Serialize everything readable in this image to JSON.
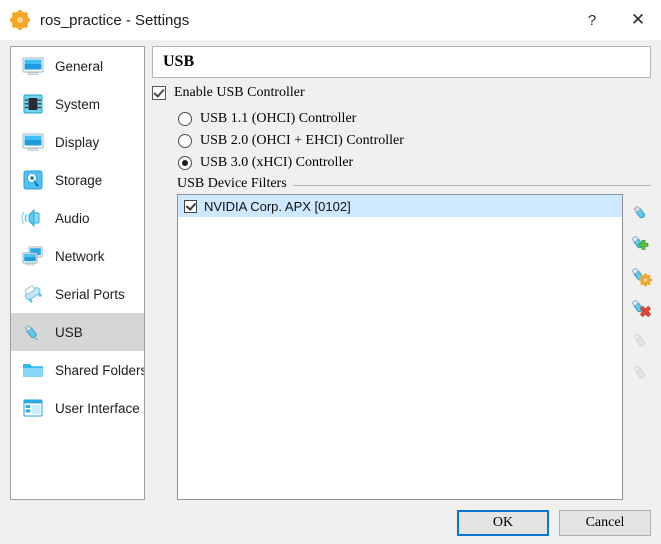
{
  "window": {
    "title": "ros_practice - Settings",
    "app_icon": "virtualbox-gear-icon",
    "help_label": "?",
    "close_label": "✕"
  },
  "sidebar": {
    "items": [
      {
        "label": "General",
        "icon": "monitor-icon",
        "selected": false
      },
      {
        "label": "System",
        "icon": "chip-icon",
        "selected": false
      },
      {
        "label": "Display",
        "icon": "display-icon",
        "selected": false
      },
      {
        "label": "Storage",
        "icon": "harddisk-icon",
        "selected": false
      },
      {
        "label": "Audio",
        "icon": "speaker-icon",
        "selected": false
      },
      {
        "label": "Network",
        "icon": "network-icon",
        "selected": false
      },
      {
        "label": "Serial Ports",
        "icon": "serial-port-icon",
        "selected": false
      },
      {
        "label": "USB",
        "icon": "usb-icon",
        "selected": true
      },
      {
        "label": "Shared Folders",
        "icon": "folder-icon",
        "selected": false
      },
      {
        "label": "User Interface",
        "icon": "window-icon",
        "selected": false
      }
    ]
  },
  "pane": {
    "header": "USB",
    "enable_controller": {
      "label": "Enable USB Controller",
      "checked": true
    },
    "controller_options": [
      {
        "label": "USB 1.1 (OHCI) Controller",
        "selected": false
      },
      {
        "label": "USB 2.0 (OHCI + EHCI) Controller",
        "selected": false
      },
      {
        "label": "USB 3.0 (xHCI) Controller",
        "selected": true
      }
    ],
    "filters_group_label": "USB Device Filters",
    "filters": [
      {
        "label": "NVIDIA Corp. APX [0102]",
        "checked": true,
        "selected": true
      }
    ],
    "filter_tools": [
      {
        "name": "add-empty-filter-icon",
        "enabled": true
      },
      {
        "name": "add-filter-from-device-icon",
        "enabled": true
      },
      {
        "name": "edit-filter-icon",
        "enabled": true
      },
      {
        "name": "remove-filter-icon",
        "enabled": true
      },
      {
        "name": "move-filter-up-icon",
        "enabled": false
      },
      {
        "name": "move-filter-down-icon",
        "enabled": false
      }
    ]
  },
  "footer": {
    "ok_label": "OK",
    "cancel_label": "Cancel"
  },
  "colors": {
    "dialog_bg": "#f0f0f0",
    "selection_blue": "#cde8ff",
    "sidebar_selection": "#d6d6d6",
    "focus_blue": "#0a76d1",
    "icon_blue": "#29abe2"
  }
}
